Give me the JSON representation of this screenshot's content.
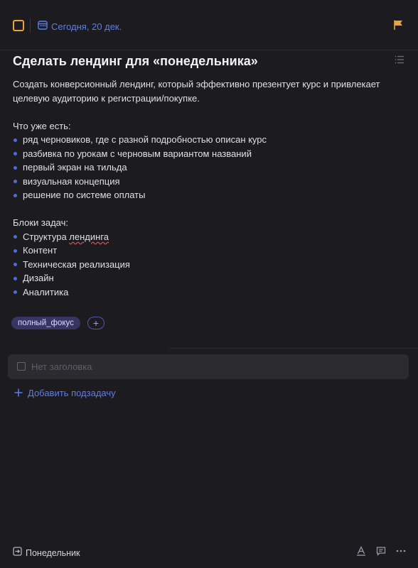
{
  "header": {
    "date_label": "Сегодня, 20 дек.",
    "priority_color": "#e8a33a",
    "accent_color": "#5b7df0",
    "icons": [
      "calendar-icon",
      "flag-icon",
      "menu-icon"
    ]
  },
  "task": {
    "title": "Сделать лендинг для «понедельника»",
    "description_line1": "Создать конверсионный лендинг, который эффективно презентует курс и привлекает",
    "description_line2": "целевую аудиторию к регистрации/покупке.",
    "existing_heading": "Что уже есть:",
    "existing_items": [
      "ряд черновиков, где с разной подробностью описан курс",
      "разбивка по урокам с черновым вариантом названий",
      "первый экран на тильда",
      "визуальная концепция",
      "решение по системе оплаты"
    ],
    "blocks_heading": "Блоки задач:",
    "blocks_items": [
      {
        "prefix": "Структура ",
        "underlined": "лендинга"
      },
      {
        "text": "Контент"
      },
      {
        "text": "Техническая реализация"
      },
      {
        "text": "Дизайн"
      },
      {
        "text": "Аналитика"
      }
    ],
    "tags": [
      "полный_фокус"
    ],
    "add_tag_label": "+"
  },
  "subtask": {
    "placeholder": "Нет заголовка",
    "add_label": "Добавить подзадачу",
    "add_icon": "plus-icon"
  },
  "footer": {
    "list_name": "Понедельник",
    "icons": [
      "move-list-icon",
      "text-format-icon",
      "comment-icon",
      "more-icon"
    ]
  }
}
